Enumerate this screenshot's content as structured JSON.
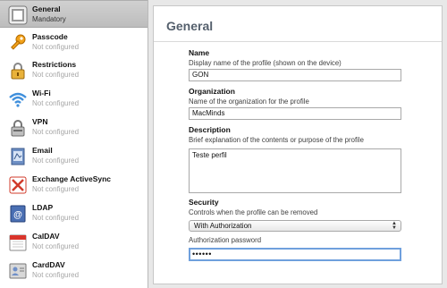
{
  "sidebar": {
    "items": [
      {
        "title": "General",
        "subtitle": "Mandatory",
        "icon": "general-icon",
        "selected": true
      },
      {
        "title": "Passcode",
        "subtitle": "Not configured",
        "icon": "key-icon"
      },
      {
        "title": "Restrictions",
        "subtitle": "Not configured",
        "icon": "lock-icon"
      },
      {
        "title": "Wi-Fi",
        "subtitle": "Not configured",
        "icon": "wifi-icon"
      },
      {
        "title": "VPN",
        "subtitle": "Not configured",
        "icon": "vpn-lock-icon"
      },
      {
        "title": "Email",
        "subtitle": "Not configured",
        "icon": "email-icon"
      },
      {
        "title": "Exchange ActiveSync",
        "subtitle": "Not configured",
        "icon": "exchange-icon"
      },
      {
        "title": "LDAP",
        "subtitle": "Not configured",
        "icon": "ldap-icon"
      },
      {
        "title": "CalDAV",
        "subtitle": "Not configured",
        "icon": "calendar-icon"
      },
      {
        "title": "CardDAV",
        "subtitle": "Not configured",
        "icon": "contacts-icon"
      }
    ]
  },
  "main": {
    "title": "General",
    "name": {
      "label": "Name",
      "description": "Display name of the profile (shown on the device)",
      "value": "GON"
    },
    "organization": {
      "label": "Organization",
      "description": "Name of the organization for the profile",
      "value": "MacMinds"
    },
    "description_field": {
      "label": "Description",
      "description": "Brief explanation of the contents or purpose of the profile",
      "value": "Teste perfil"
    },
    "security": {
      "label": "Security",
      "description": "Controls when the profile can be removed",
      "selected": "With Authorization"
    },
    "auth_password": {
      "label": "Authorization password",
      "value": "••••••"
    }
  },
  "colors": {
    "focus_ring": "#6fa0dd",
    "title": "#55606d",
    "selected_row": "#c6c6c6"
  }
}
